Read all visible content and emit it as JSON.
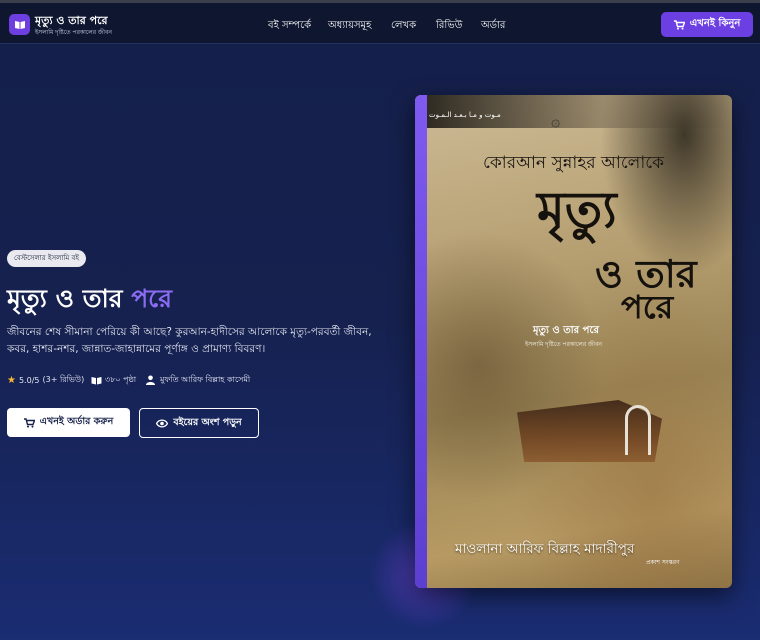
{
  "header": {
    "brand_title": "মৃত্যু ও তার পরে",
    "brand_subtitle": "ইসলামি দৃষ্টিতে পরকালের জীবন",
    "nav": [
      "বই সম্পর্কে",
      "অধ্যায়সমূহ",
      "লেখক",
      "রিভিউ",
      "অর্ডার"
    ],
    "buy_label": "এখনই কিনুন",
    "icons": {
      "logo": "book-icon",
      "buy": "cart-icon"
    }
  },
  "hero": {
    "badge": "বেস্টসেলার ইসলামি বই",
    "title_main": "মৃত্যু ও তার",
    "title_accent": "পরে",
    "description": "জীবনের শেষ সীমানা পেরিয়ে কী আছে? কুরআন-হাদীসের আলোকে মৃত্যু-পরবর্তী জীবন, কবর, হাশর-নশর, জান্নাত-জাহান্নামের পূর্ণাঙ্গ ও প্রামাণ্য বিবরণ।",
    "meta": {
      "rating": "5.0/5",
      "reviews": "(3+ রিভিউ)",
      "pages": "৩৮০ পৃষ্ঠা",
      "author": "মুফতি আরিফ বিল্লাহ কাসেমী"
    },
    "primary_button": "এখনই অর্ডার করুন",
    "secondary_button": "বইয়ের অংশ পড়ুন",
    "icons": {
      "rating": "star-icon",
      "pages": "open-book-icon",
      "author": "user-icon",
      "primary": "cart-icon",
      "secondary": "eye-icon"
    },
    "colors": {
      "accent": "#8b6cf2",
      "brand": "#6c3fe3",
      "star": "#f5b82e"
    }
  },
  "cover": {
    "arabic_line": "مـوت و مـا بـعـد الـمـوت",
    "arabic_mark": "۞",
    "top_line": "কোরআন সুন্নাহর আলোকে",
    "big_line1": "মৃত্যু",
    "big_line2": "ও তার",
    "big_line3": "পরে",
    "sub_title": "মৃত্যু ও তার পরে",
    "sub_caption": "ইসলামি দৃষ্টিতে পরকালের জীবন",
    "author": "মাওলানা আরিফ বিল্লাহ মাদারীপুর",
    "publisher": "প্রকাশ সংস্করণ"
  }
}
